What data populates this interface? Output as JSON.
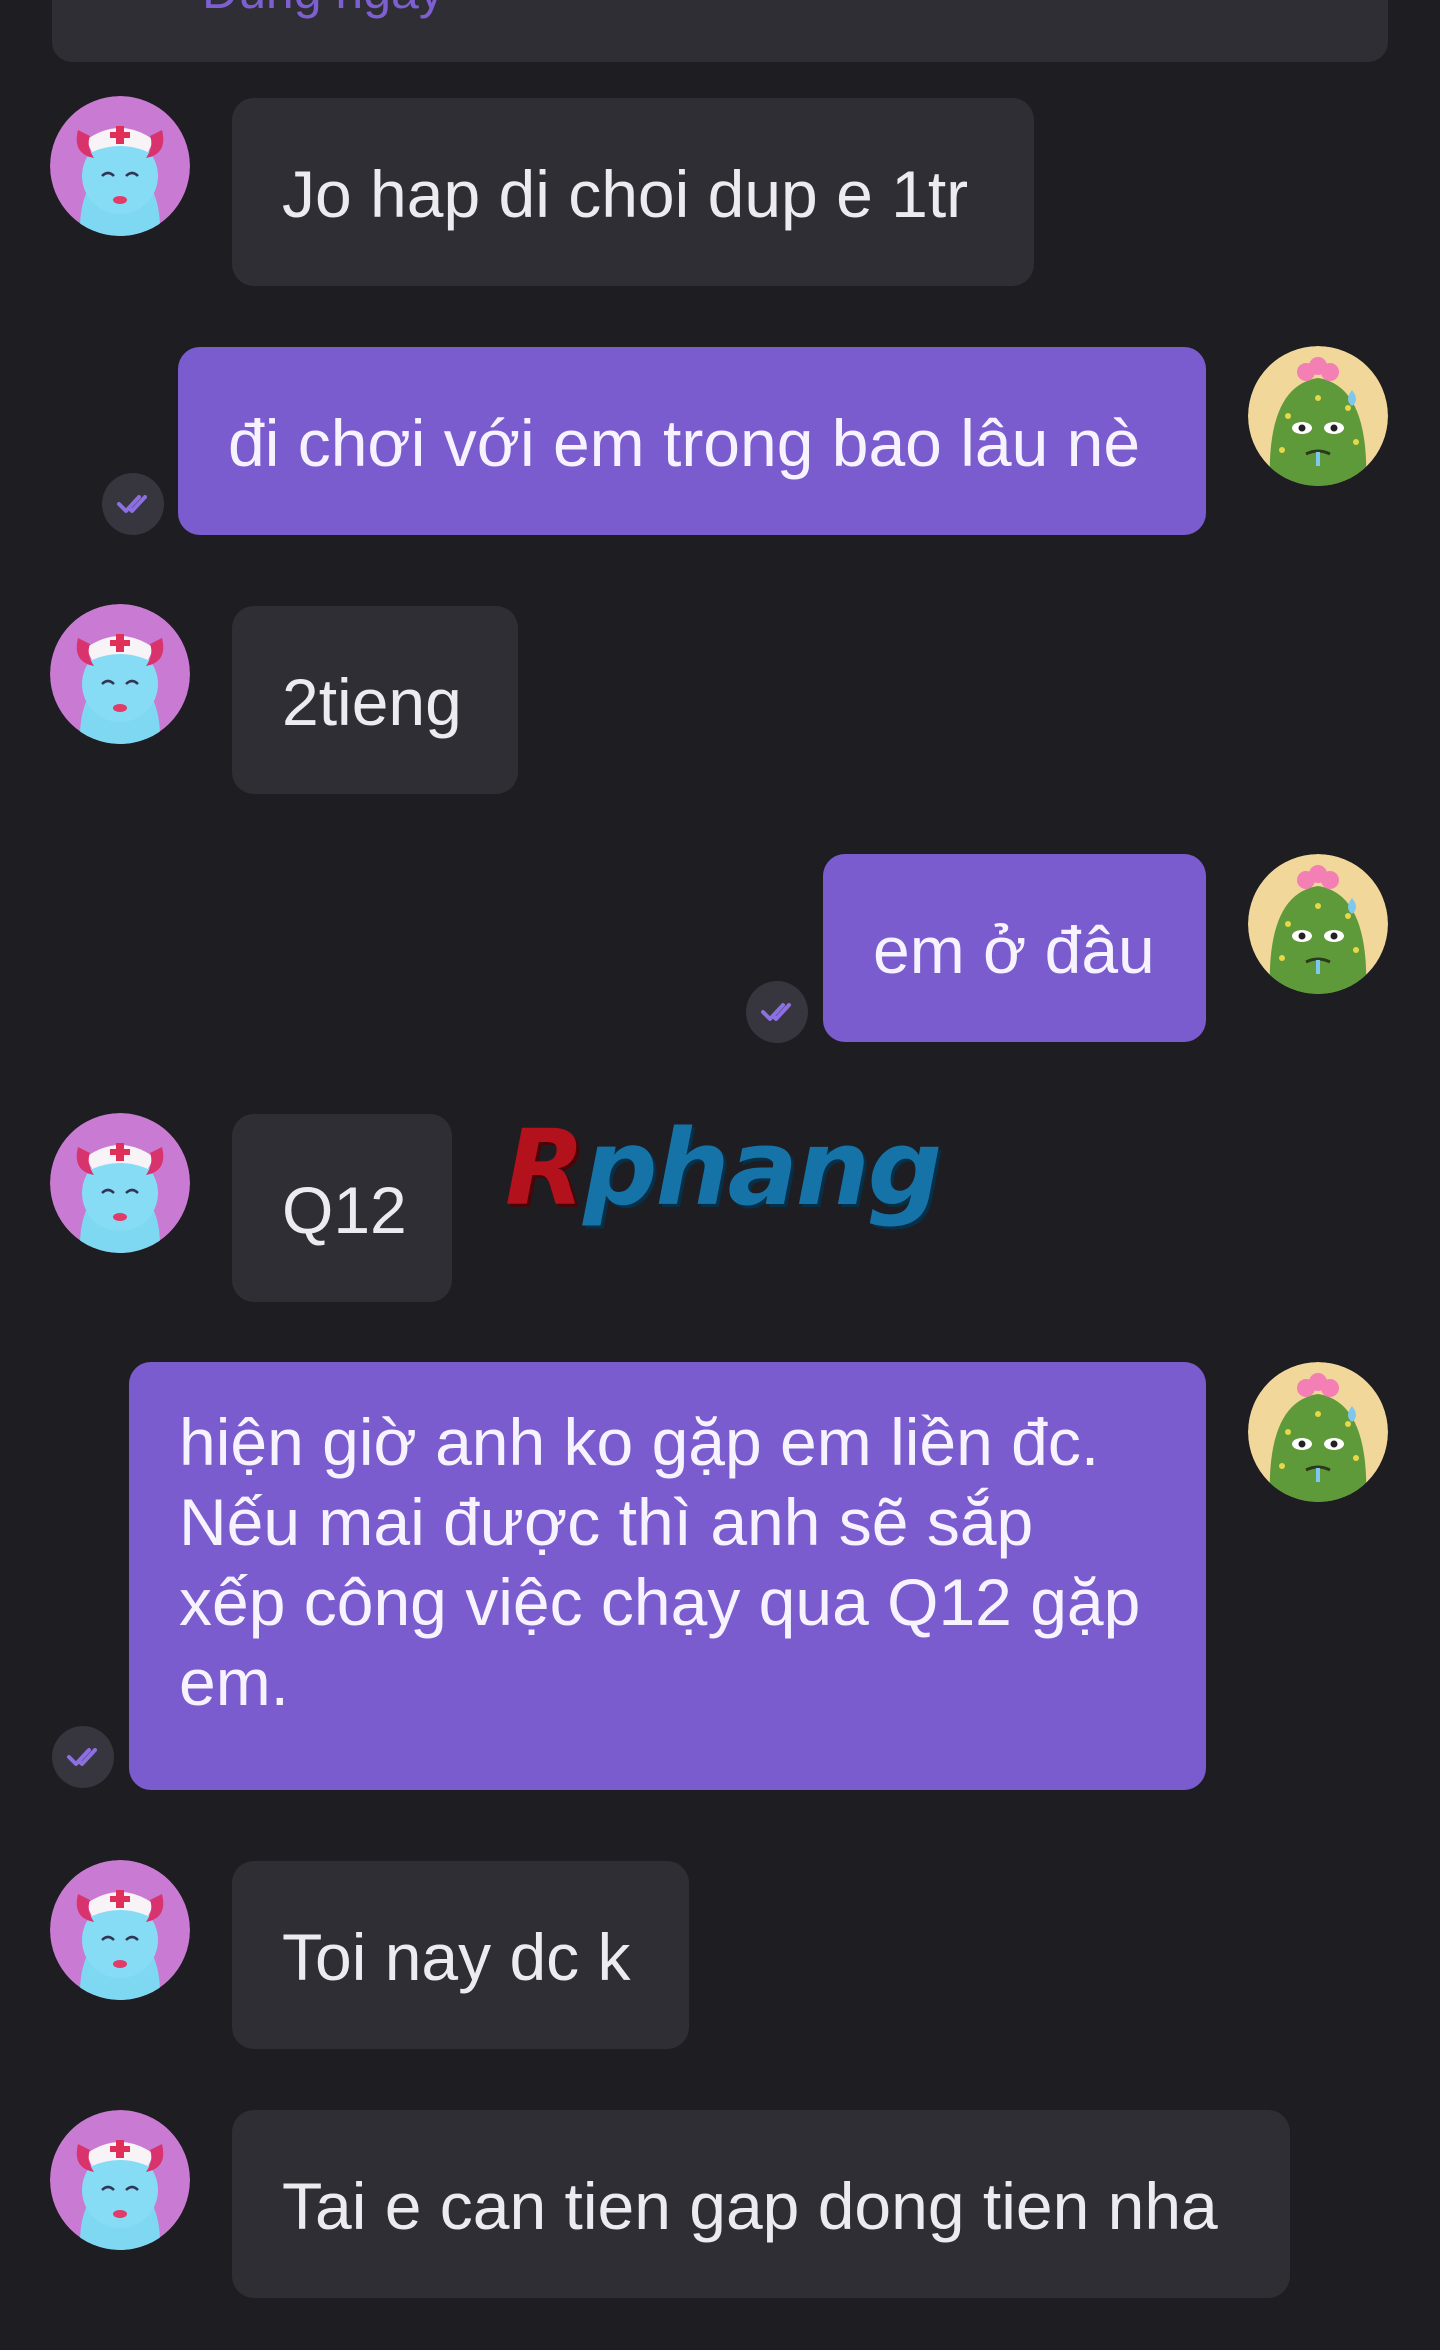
{
  "previous_message": {
    "text": "Đúng ngày"
  },
  "messages": [
    {
      "sender": "contact",
      "text": "Jo hap di choi dup e 1tr"
    },
    {
      "sender": "me",
      "text": "đi chơi với em trong bao lâu nè",
      "status": "read"
    },
    {
      "sender": "contact",
      "text": "2tieng"
    },
    {
      "sender": "me",
      "text": "em ở đâu",
      "status": "read"
    },
    {
      "sender": "contact",
      "text": "Q12"
    },
    {
      "sender": "me",
      "lines": [
        "hiện giờ anh ko gặp em liền đc.",
        "Nếu mai được thì anh sẽ sắp",
        "xếp công việc chạy qua Q12 gặp",
        "em."
      ],
      "status": "read"
    },
    {
      "sender": "contact",
      "text": "Toi nay dc k"
    },
    {
      "sender": "contact",
      "text": "Tai e can tien gap dong tien nha"
    }
  ],
  "watermark": {
    "first": "R",
    "rest": "phang"
  },
  "icons": {
    "contact_avatar": "nurse-devil-avatar-icon",
    "my_avatar": "cactus-avatar-icon",
    "read_receipt": "double-check-icon"
  },
  "colors": {
    "background": "#1e1d22",
    "incoming_bubble": "#2f2e34",
    "outgoing_bubble": "#7b5ccf",
    "text": "#ececf0"
  }
}
